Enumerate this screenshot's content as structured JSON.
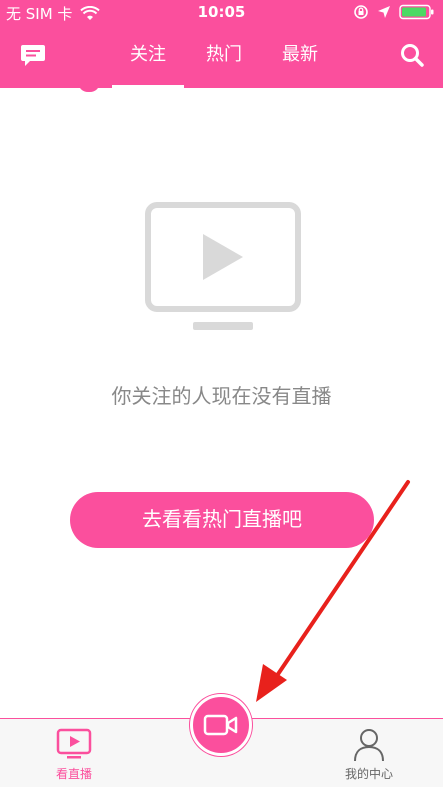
{
  "statusbar": {
    "carrier": "无 SIM 卡",
    "time": "10:05"
  },
  "navbar": {
    "tabs": [
      {
        "label": "关注",
        "active": true
      },
      {
        "label": "热门",
        "active": false
      },
      {
        "label": "最新",
        "active": false
      }
    ],
    "left_icon": "message-icon",
    "right_icon": "search-icon"
  },
  "main": {
    "empty_message": "你关注的人现在没有直播",
    "go_hot_button": "去看看热门直播吧",
    "empty_icon": "tv-play-icon"
  },
  "tabbar": {
    "items": [
      {
        "label": "看直播",
        "icon": "tv-play-icon",
        "active": true
      },
      {
        "label": "",
        "icon": "video-camera-icon",
        "active": false
      },
      {
        "label": "我的中心",
        "icon": "user-icon",
        "active": false
      }
    ]
  },
  "colors": {
    "accent": "#fb4f9d",
    "arrow": "#e8211c",
    "muted_text": "#888888"
  }
}
